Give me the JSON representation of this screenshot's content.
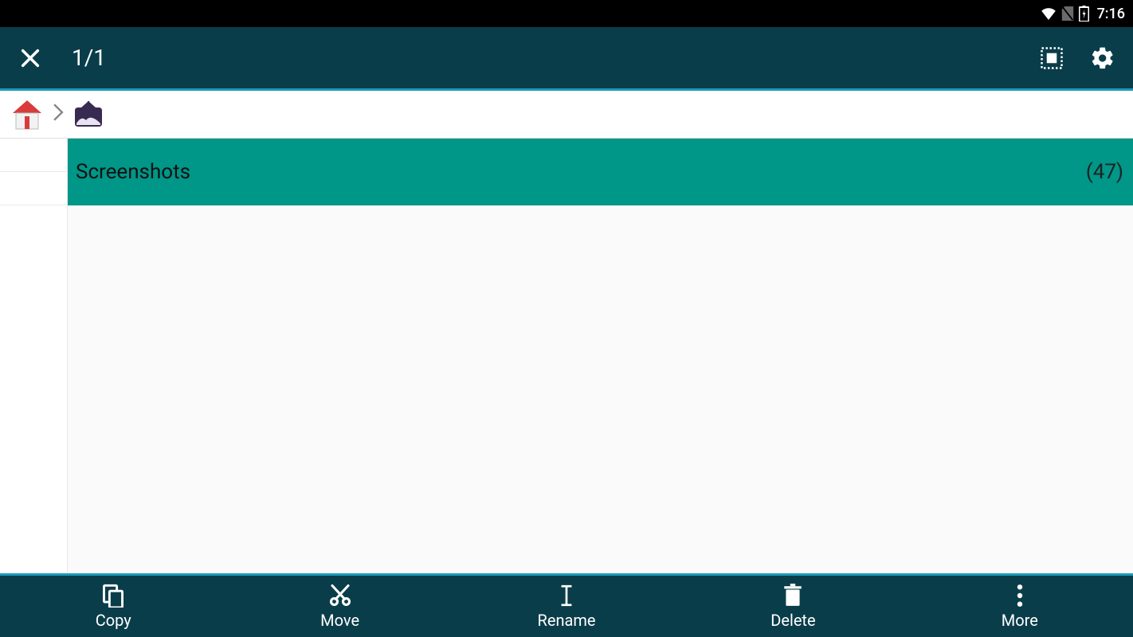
{
  "status": {
    "time": "7:16"
  },
  "appbar": {
    "title": "1/1"
  },
  "list": {
    "items": [
      {
        "name": "Screenshots",
        "count": "(47)"
      }
    ]
  },
  "bottom": {
    "copy": "Copy",
    "move": "Move",
    "rename": "Rename",
    "delete": "Delete",
    "more": "More"
  }
}
